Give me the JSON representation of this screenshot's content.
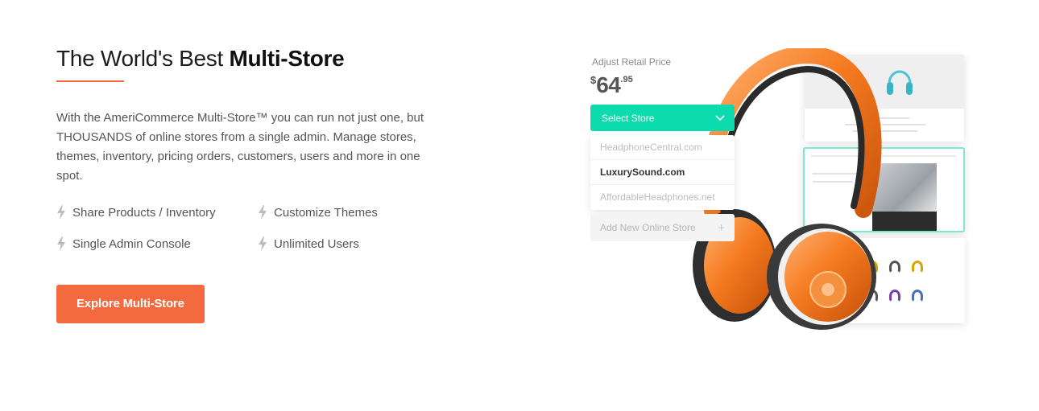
{
  "heading": {
    "light": "The World's Best ",
    "bold": "Multi-Store"
  },
  "description": "With the AmeriCommerce Multi-Store™ you can run not just one, but THOUSANDS of online stores from a single admin. Manage stores, themes, inventory, pricing orders, customers, users and more in one spot.",
  "features": [
    {
      "label": "Share Products / Inventory",
      "icon": "bolt-icon"
    },
    {
      "label": "Customize Themes",
      "icon": "bolt-icon"
    },
    {
      "label": "Single Admin Console",
      "icon": "bolt-icon"
    },
    {
      "label": "Unlimited Users",
      "icon": "bolt-icon"
    }
  ],
  "cta_label": "Explore Multi-Store",
  "illustration": {
    "price_label": "Adjust Retail Price",
    "price": {
      "currency": "$",
      "dollars": "64",
      "cents": ".95"
    },
    "select_label": "Select Store",
    "stores": [
      "HeadphoneCentral.com",
      "LuxurySound.com",
      "AffordableHeadphones.net"
    ],
    "selected_store": "LuxurySound.com",
    "add_store_label": "Add New Online Store",
    "add_icon": "plus-icon"
  },
  "colors": {
    "accent": "#f26a3d",
    "teal": "#0cdcad",
    "text": "#555555"
  }
}
